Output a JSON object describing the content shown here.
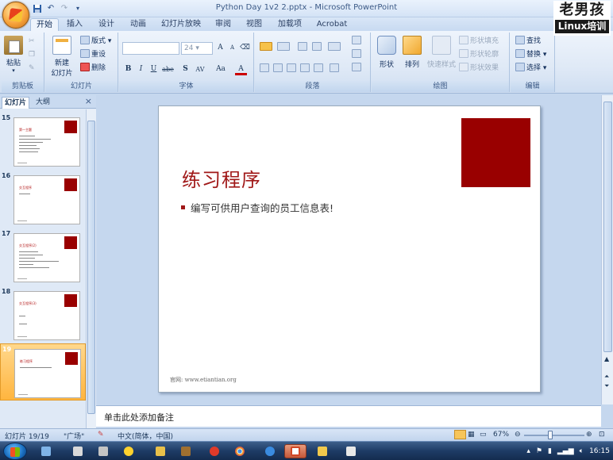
{
  "window": {
    "title": "Python Day 1v2 2.pptx - Microsoft PowerPoint"
  },
  "brand": {
    "line1": "老男孩",
    "line2": "Linux培训"
  },
  "qat": [
    "save",
    "undo",
    "redo",
    "more"
  ],
  "tabs": [
    "开始",
    "插入",
    "设计",
    "动画",
    "幻灯片放映",
    "审阅",
    "视图",
    "加载项",
    "Acrobat"
  ],
  "active_tab": "开始",
  "ribbon": {
    "clipboard": {
      "label": "剪贴板",
      "paste": "粘贴"
    },
    "slides": {
      "label": "幻灯片",
      "new_slide_1": "新建",
      "new_slide_2": "幻灯片",
      "layout": "版式",
      "reset": "重设",
      "delete": "删除"
    },
    "font": {
      "label": "字体",
      "font_size": "24",
      "font_name": "",
      "bold": "B",
      "italic": "I",
      "underline": "U",
      "strike": "abe",
      "shadow": "S",
      "spacing": "AV",
      "case": "Aa",
      "color": "A",
      "grow": "A",
      "shrink": "A"
    },
    "paragraph": {
      "label": "段落"
    },
    "drawing": {
      "label": "绘图",
      "shape": "形状",
      "arrange": "排列",
      "quick_style": "快速样式",
      "fill": "形状填充",
      "outline": "形状轮廓",
      "effects": "形状效果"
    },
    "editing": {
      "label": "编辑",
      "find": "查找",
      "replace": "替换",
      "select": "选择"
    }
  },
  "pane": {
    "tab_slides": "幻灯片",
    "tab_outline": "大纲",
    "close": "×"
  },
  "thumbnails": [
    {
      "num": "15",
      "title": "第一主题"
    },
    {
      "num": "16",
      "title": "交互程序"
    },
    {
      "num": "17",
      "title": "交互程序(2)"
    },
    {
      "num": "18",
      "title": "交互程序(3)"
    },
    {
      "num": "19",
      "title": "练习程序",
      "selected": true
    }
  ],
  "slide": {
    "title": "练习程序",
    "bullet": "编写可供用户查询的员工信息表!",
    "footer": "官网: www.etiantian.org",
    "accent": "#990000"
  },
  "notes": {
    "placeholder": "单击此处添加备注"
  },
  "status": {
    "slide_count": "幻灯片 19/19",
    "theme": "\"广场\"",
    "language": "中文(简体，中国)",
    "zoom": "67%",
    "zoom_fraction": 0.44
  },
  "clock": "16:15"
}
